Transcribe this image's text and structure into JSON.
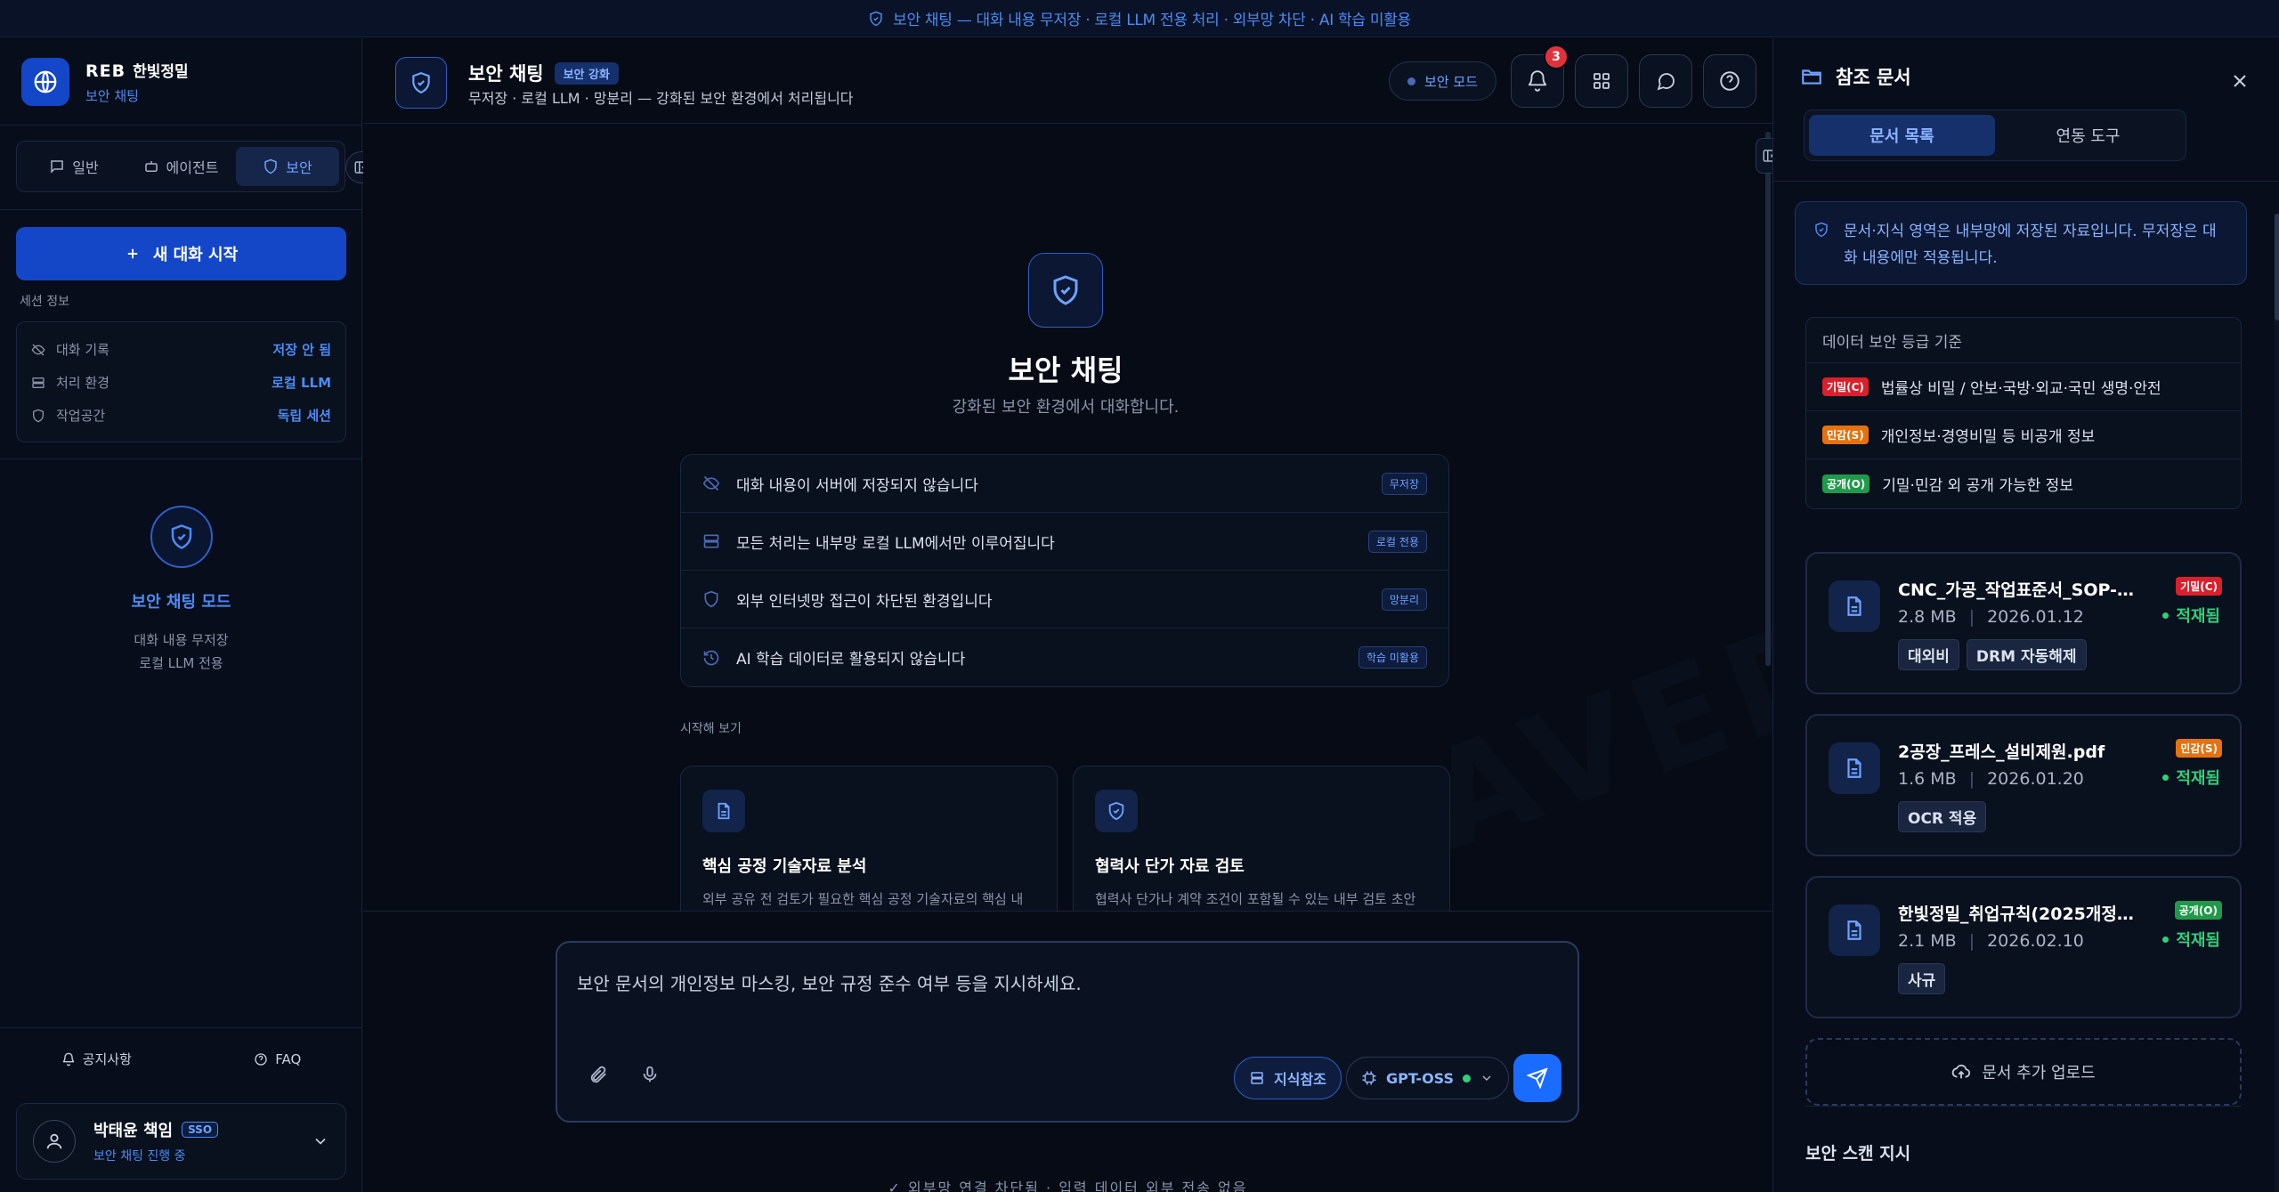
{
  "banner": {
    "text": "보안 채팅 — 대화 내용 무저장 · 로컬 LLM 전용 처리 · 외부망 차단 · AI 학습 미활용"
  },
  "brand": {
    "name": "REB",
    "company": "한빛정밀",
    "tag": "보안 채팅"
  },
  "modes": [
    {
      "label": "일반",
      "icon": "chat-icon"
    },
    {
      "label": "에이전트",
      "icon": "robot-icon"
    },
    {
      "label": "보안",
      "icon": "shield-icon",
      "active": true
    }
  ],
  "new_chat": {
    "label": "새 대화 시작"
  },
  "session": {
    "label": "세션 정보",
    "rows": [
      {
        "label": "대화 기록",
        "value": "저장 안 됨",
        "icon": "eye-off-icon"
      },
      {
        "label": "처리 환경",
        "value": "로컬 LLM",
        "icon": "server-icon"
      },
      {
        "label": "작업공간",
        "value": "독립 세션",
        "icon": "shield-icon"
      }
    ]
  },
  "secure_mode": {
    "title": "보안 채팅 모드",
    "line1": "대화 내용 무저장",
    "line2": "로컬 LLM 전용"
  },
  "footer_links": {
    "notice": "공지사항",
    "faq": "FAQ"
  },
  "user": {
    "name": "박태윤 책임",
    "badge": "SSO",
    "status": "보안 채팅 진행 중"
  },
  "header": {
    "title": "보안 채팅",
    "badge": "보안 강화",
    "subtitle": "무저장 · 로컬 LLM · 망분리 — 강화된 보안 환경에서 처리됩니다",
    "mode_label": "보안 모드",
    "notification_count": "3"
  },
  "hero": {
    "title": "보안 채팅",
    "subtitle": "강화된 보안 환경에서 대화합니다."
  },
  "watermark": "NOT SAVED",
  "features": [
    {
      "text": "대화 내용이 서버에 저장되지 않습니다",
      "tag": "무저장",
      "icon": "eye-off-icon"
    },
    {
      "text": "모든 처리는 내부망 로컬 LLM에서만 이루어집니다",
      "tag": "로컬 전용",
      "icon": "server-icon"
    },
    {
      "text": "외부 인터넷망 접근이 차단된 환경입니다",
      "tag": "망분리",
      "icon": "shield-icon"
    },
    {
      "text": "AI 학습 데이터로 활용되지 않습니다",
      "tag": "학습 미활용",
      "icon": "history-icon"
    }
  ],
  "start_label": "시작해 보기",
  "cards": [
    {
      "title": "핵심 공정 기술자료 분석",
      "desc": "외부 공유 전 검토가 필요한 핵심 공정 기술자료의 핵심 내",
      "icon": "document-icon"
    },
    {
      "title": "협력사 단가 자료 검토",
      "desc": "협력사 단가나 계약 조건이 포함될 수 있는 내부 검토 초안",
      "icon": "shield-icon"
    }
  ],
  "composer": {
    "placeholder": "보안 문서의 개인정보 마스킹, 보안 규정 준수 여부 등을 지시하세요.",
    "knowledge_label": "지식참조",
    "model_label": "GPT-OSS"
  },
  "footnote": "✓ 외부망 연결 차단됨 · 입력 데이터 외부 전송 없음",
  "right_panel": {
    "title": "참조 문서",
    "tabs": [
      {
        "label": "문서 목록",
        "active": true
      },
      {
        "label": "연동 도구"
      }
    ],
    "info": "문서·지식 영역은 내부망에 저장된 자료입니다. 무저장은 대화 내용에만 적용됩니다.",
    "grade_title": "데이터 보안 등급 기준",
    "grades": [
      {
        "tag": "기밀(C)",
        "color": "#d9202c",
        "desc": "법률상 비밀 / 안보·국방·외교·국민 생명·안전"
      },
      {
        "tag": "민감(S)",
        "color": "#e5720f",
        "desc": "개인정보·경영비밀 등 비공개 정보"
      },
      {
        "tag": "공개(O)",
        "color": "#1f9a4a",
        "desc": "기밀·민감 외 공개 가능한 정보"
      }
    ],
    "docs": [
      {
        "name": "CNC_가공_작업표준서_SOP-0...",
        "size": "2.8 MB",
        "date": "2026.01.12",
        "tags": [
          "대외비",
          "DRM 자동해제"
        ],
        "grade": "기밀(C)",
        "grade_color": "#d9202c",
        "status": "적재됨"
      },
      {
        "name": "2공장_프레스_설비제원.pdf",
        "size": "1.6 MB",
        "date": "2026.01.20",
        "tags": [
          "OCR 적용"
        ],
        "grade": "민감(S)",
        "grade_color": "#e5720f",
        "status": "적재됨"
      },
      {
        "name": "한빛정밀_취업규칙(2025개정).h...",
        "size": "2.1 MB",
        "date": "2026.02.10",
        "tags": [
          "사규"
        ],
        "grade": "공개(O)",
        "grade_color": "#1f9a4a",
        "status": "적재됨"
      }
    ],
    "upload_label": "문서 추가 업로드",
    "scan_title": "보안 스캔 지시"
  }
}
